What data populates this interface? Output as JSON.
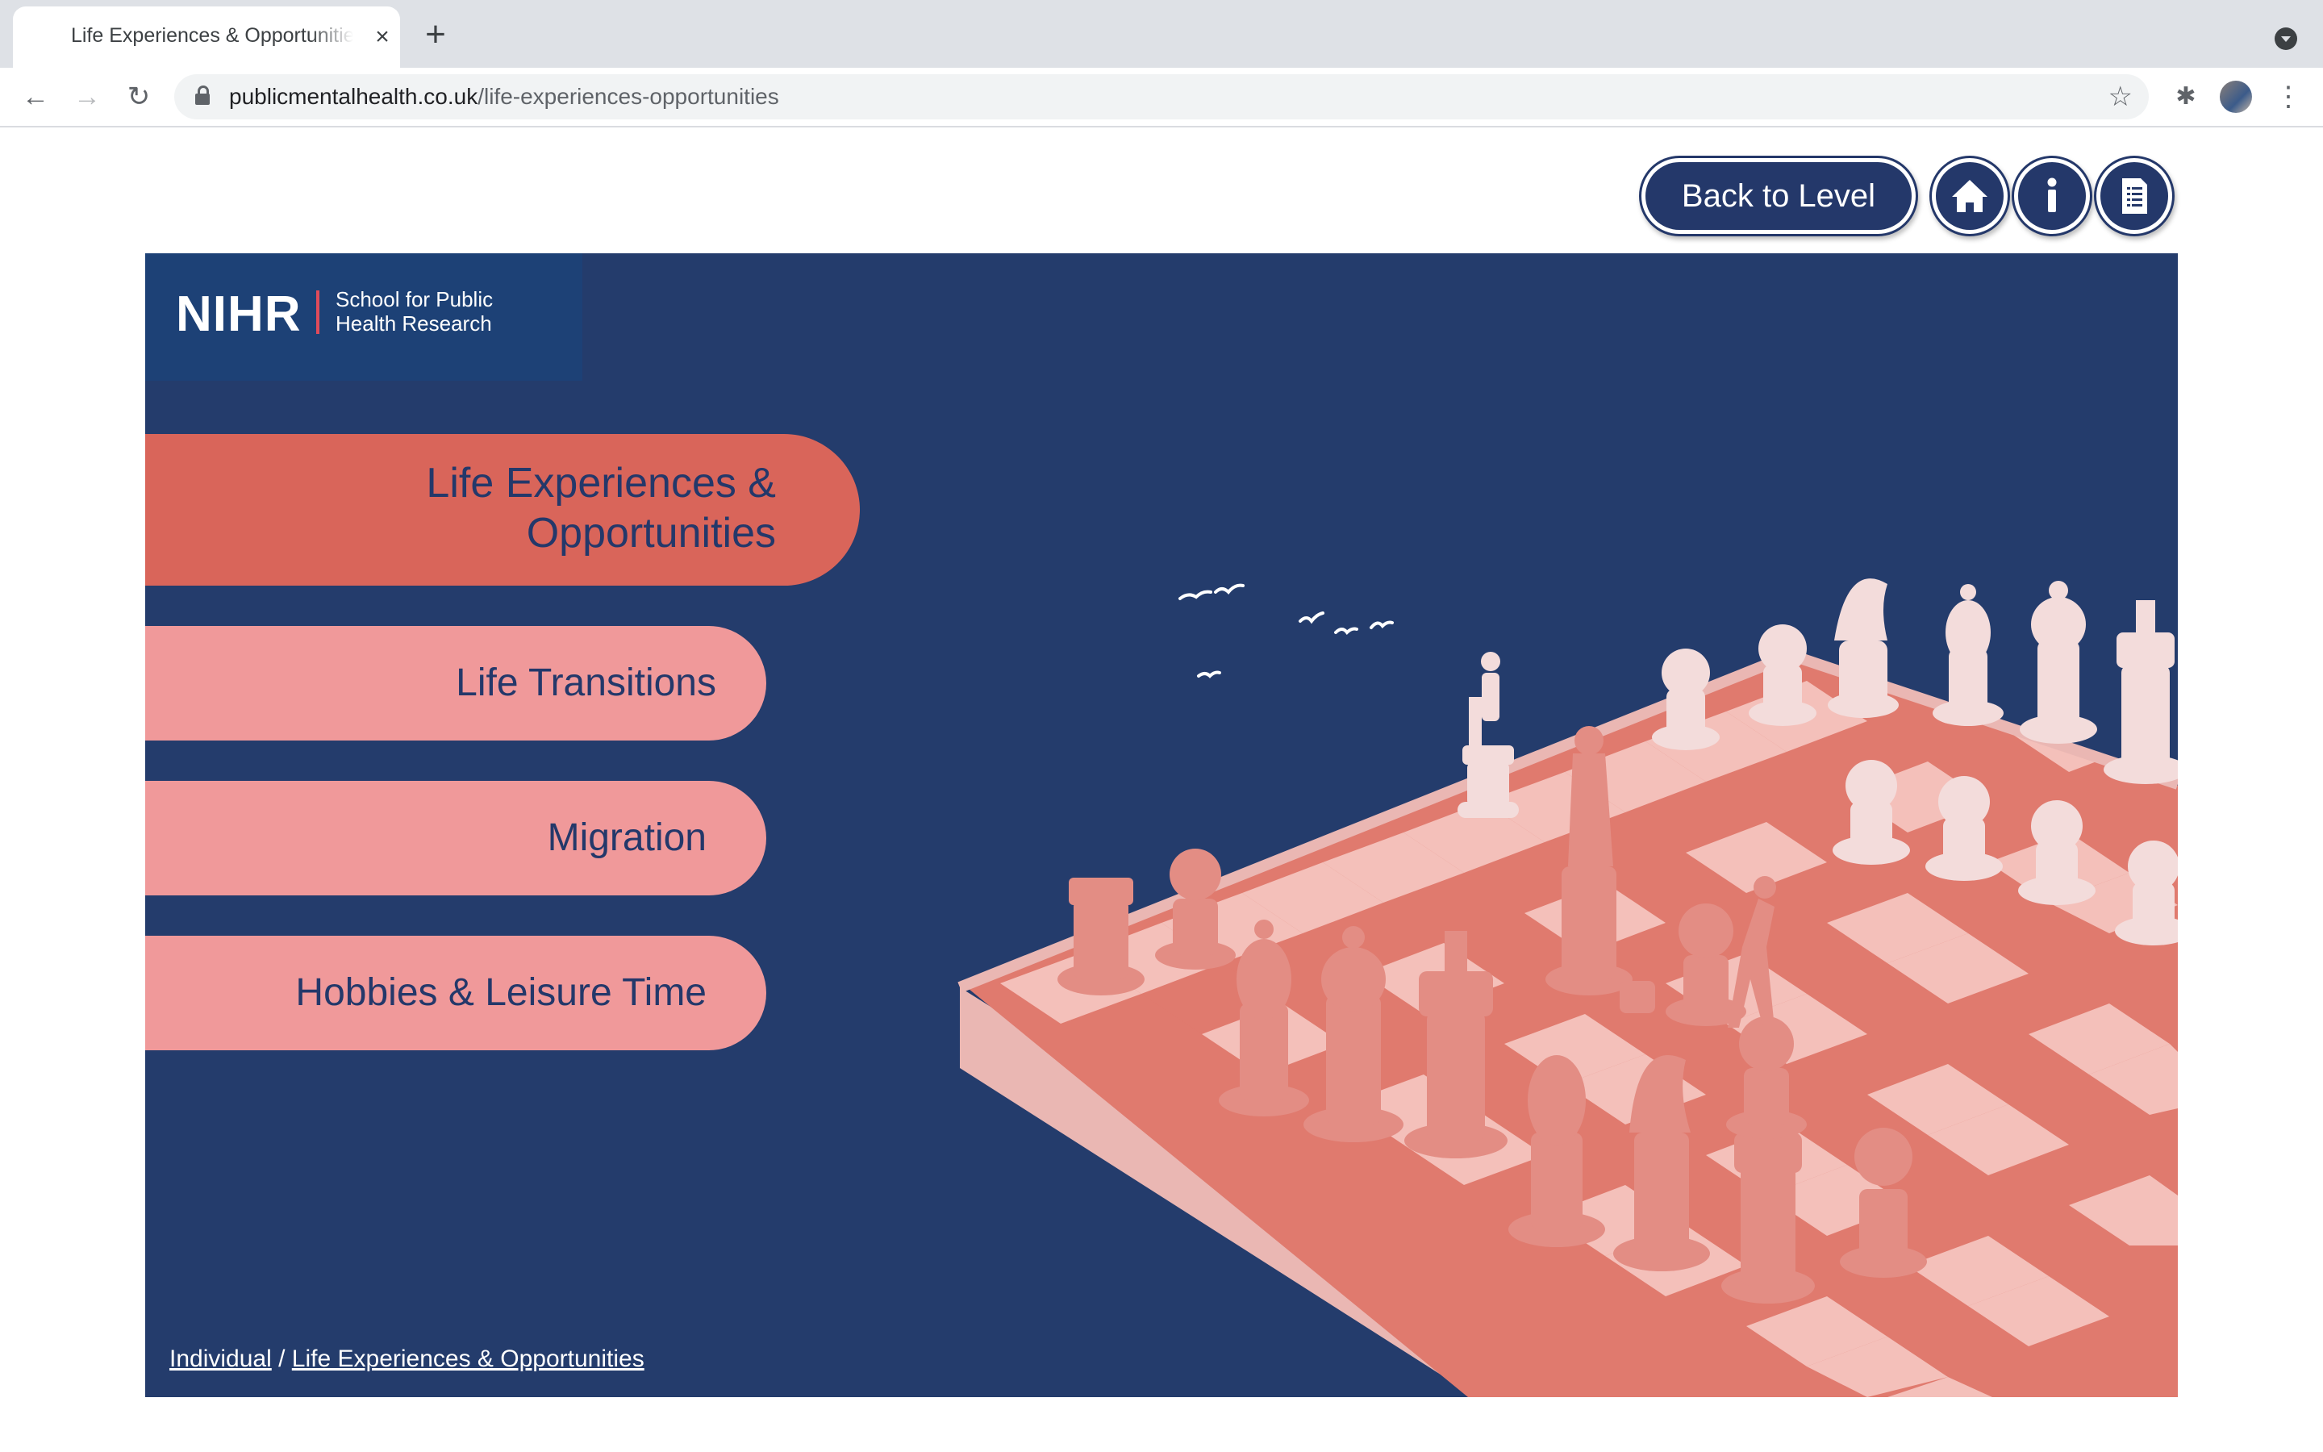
{
  "browser": {
    "tab_title": "Life Experiences & Opportunities",
    "new_tab_label": "+",
    "close_label": "×",
    "url_host": "publicmentalhealth.co.uk",
    "url_path": "/life-experiences-opportunities"
  },
  "header": {
    "back_label": "Back to Level",
    "home_icon": "home-icon",
    "info_icon": "info-icon",
    "document_icon": "document-icon",
    "button_color": "#24386a"
  },
  "logo": {
    "name": "NIHR",
    "sub_line1": "School for Public",
    "sub_line2": "Health Research"
  },
  "menu": {
    "items": [
      {
        "line1": "Life Experiences &",
        "line2": "Opportunities",
        "active": true
      },
      {
        "label": "Life Transitions",
        "active": false
      },
      {
        "label": "Migration",
        "active": false
      },
      {
        "label": "Hobbies & Leisure Time",
        "active": false
      }
    ],
    "active_color": "#d9655a",
    "inactive_color": "#f0999a",
    "text_color": "#24386a"
  },
  "breadcrumb": {
    "items": [
      "Individual",
      "Life Experiences & Opportunities"
    ],
    "separator": "/"
  },
  "colors": {
    "stage_bg": "#243c6c",
    "logo_bg": "#1d4176"
  },
  "illustration": {
    "subject": "chessboard-illustration"
  }
}
